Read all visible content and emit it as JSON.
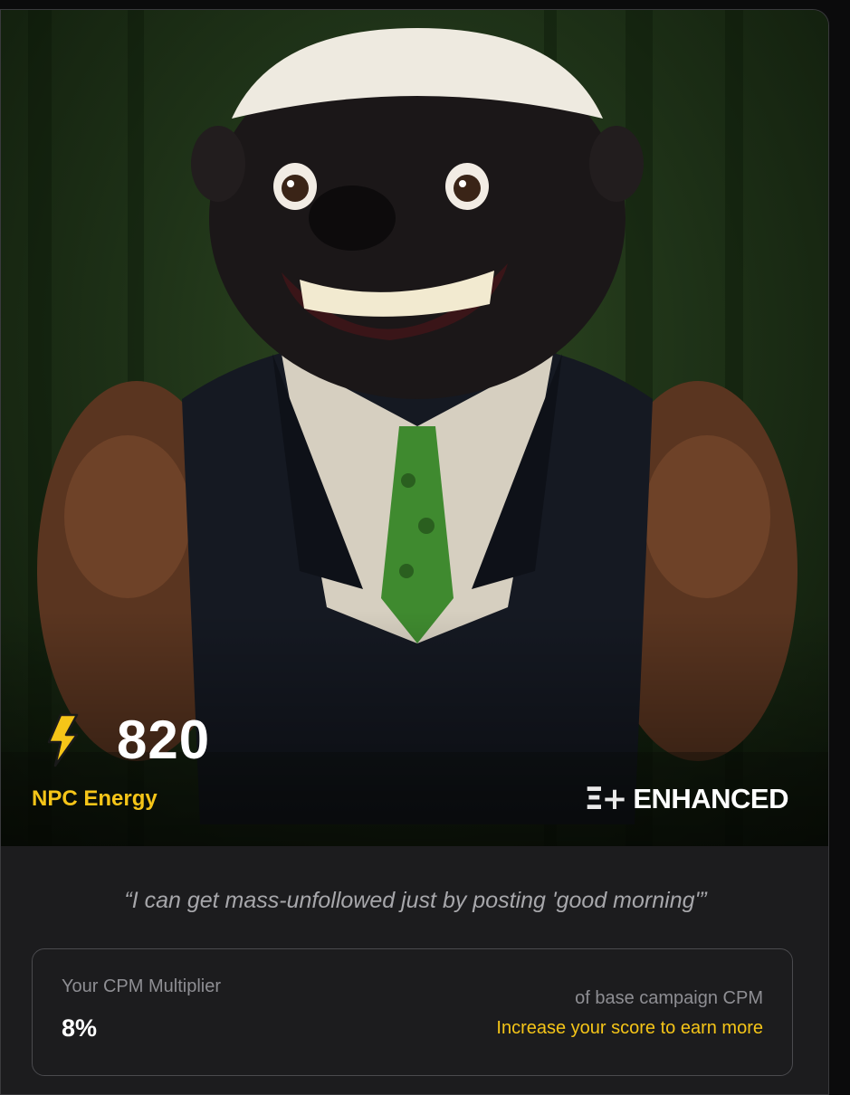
{
  "card": {
    "image_alt": "honey badger in suit vest with green snake tie",
    "score": "820",
    "score_label": "NPC Energy",
    "score_icon": "lightning-bolt-icon",
    "brand": {
      "mark": "Ξ+",
      "label": "ENHANCED"
    },
    "quote": "“I can get mass-unfollowed just by posting 'good morning'”"
  },
  "cpm": {
    "label": "Your CPM Multiplier",
    "value": "8%",
    "base_note": "of base campaign CPM",
    "cta": "Increase your score to earn more"
  },
  "colors": {
    "accent": "#f5c518",
    "background": "#1c1c1e",
    "muted_text": "#8e8e93"
  }
}
